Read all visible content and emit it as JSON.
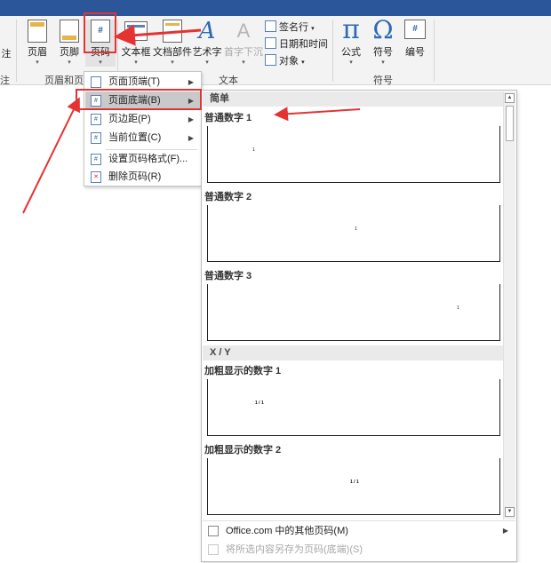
{
  "ribbon": {
    "partial_left_label": "注",
    "partial_left_group": "注",
    "buttons": {
      "header": "页眉",
      "footer": "页脚",
      "page_number": "页码",
      "text_box": "文本框",
      "quick_parts": "文档部件",
      "word_art": "艺术字",
      "drop_cap": "首字下沉",
      "equation": "公式",
      "symbol": "符号",
      "numbering": "编号"
    },
    "small_items": {
      "signature_line": "签名行",
      "date_time": "日期和时间",
      "object": "对象"
    },
    "glyphs": {
      "equation": "π",
      "symbol": "Ω",
      "numbering": "#",
      "word_art": "A",
      "drop_cap": "A",
      "page_number": "#"
    },
    "groups": {
      "header_footer": "页眉和页脚",
      "text": "文本",
      "symbols": "符号"
    }
  },
  "menu": {
    "items": [
      {
        "label": "页面顶端(T)",
        "has_submenu": true
      },
      {
        "label": "页面底端(B)",
        "has_submenu": true,
        "active": true
      },
      {
        "label": "页边距(P)",
        "has_submenu": true
      },
      {
        "label": "当前位置(C)",
        "has_submenu": true
      },
      {
        "label": "设置页码格式(F)...",
        "has_submenu": false
      },
      {
        "label": "删除页码(R)",
        "has_submenu": false
      }
    ]
  },
  "gallery": {
    "sections": {
      "simple": "简单",
      "xy": "X / Y"
    },
    "items": [
      {
        "title": "普通数字 1",
        "sample": "1"
      },
      {
        "title": "普通数字 2",
        "sample": "1"
      },
      {
        "title": "普通数字 3",
        "sample": "1"
      },
      {
        "title": "加粗显示的数字 1",
        "sample": "1 / 1"
      },
      {
        "title": "加粗显示的数字 2",
        "sample": "1 / 1"
      }
    ],
    "footer": {
      "more_from_office": "Office.com 中的其他页码(M)",
      "save_selection": "将所选内容另存为页码(底端)(S)"
    }
  },
  "colors": {
    "title_bar": "#2b579a",
    "annotation_red": "#e53333",
    "active_menu": "#c9c9c9"
  }
}
